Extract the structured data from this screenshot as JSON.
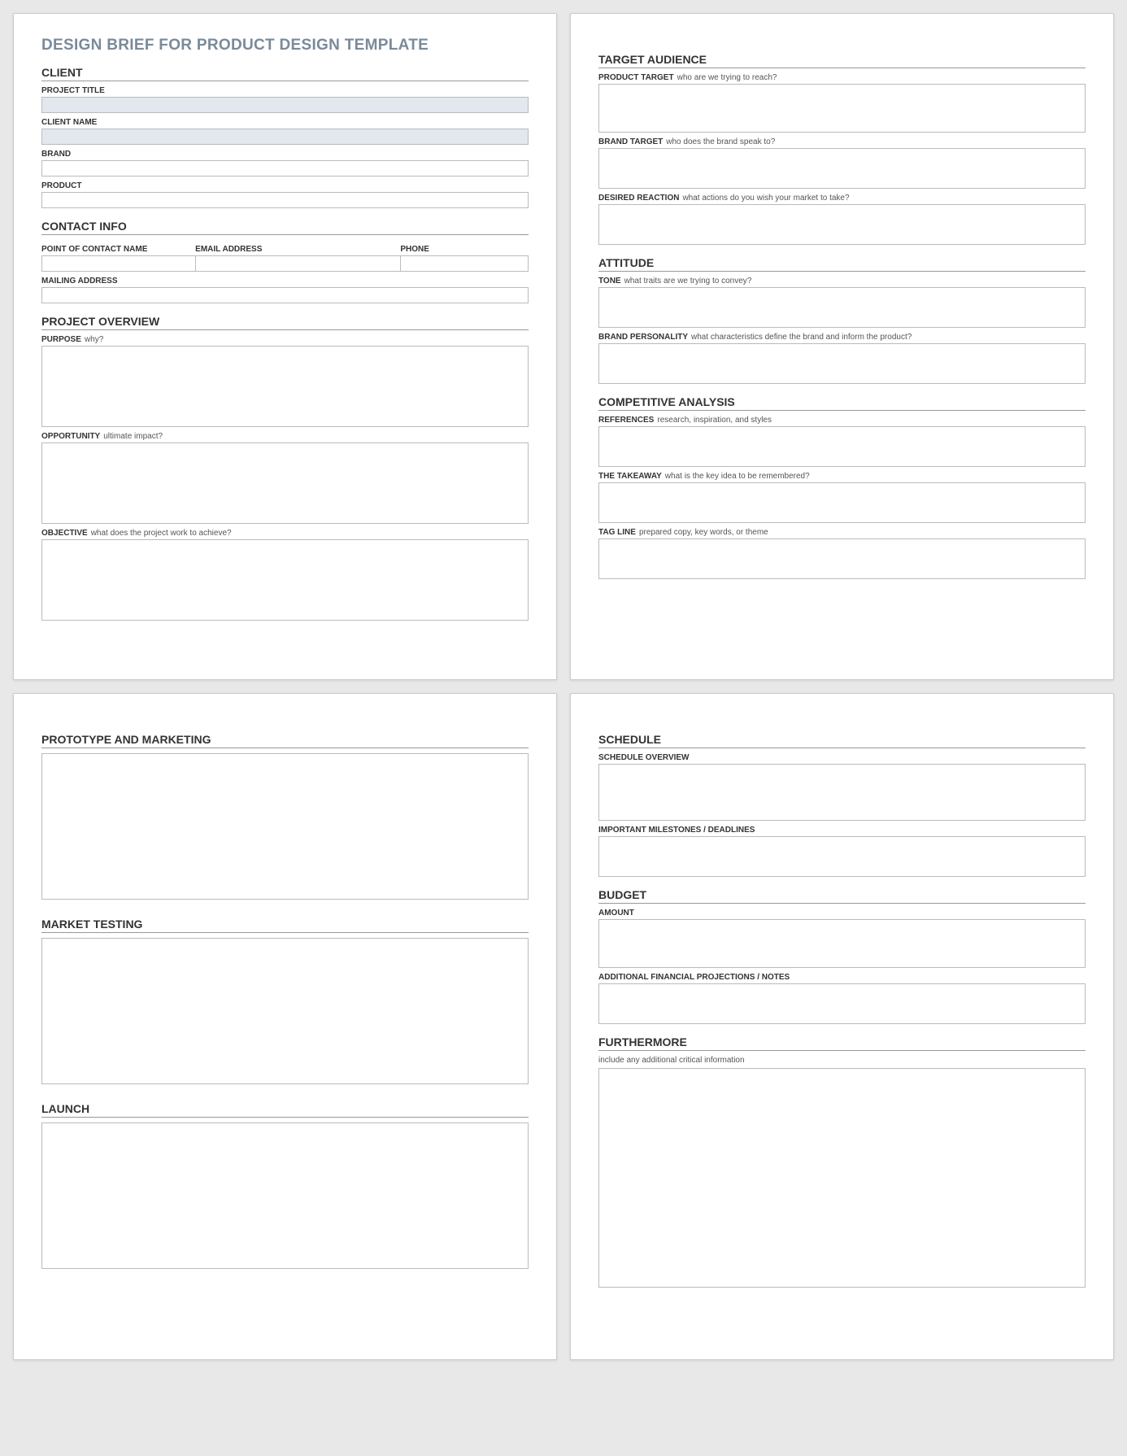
{
  "doc_title": "DESIGN BRIEF FOR PRODUCT DESIGN TEMPLATE",
  "p1l": {
    "client_head": "CLIENT",
    "project_title_label": "PROJECT TITLE",
    "client_name_label": "CLIENT NAME",
    "brand_label": "BRAND",
    "product_label": "PRODUCT",
    "contact_head": "CONTACT INFO",
    "poc_label": "POINT OF CONTACT NAME",
    "email_label": "EMAIL ADDRESS",
    "phone_label": "PHONE",
    "mailing_label": "MAILING ADDRESS",
    "overview_head": "PROJECT OVERVIEW",
    "purpose_label": "PURPOSE",
    "purpose_hint": "why?",
    "opportunity_label": "OPPORTUNITY",
    "opportunity_hint": "ultimate impact?",
    "objective_label": "OBJECTIVE",
    "objective_hint": "what does the project work to achieve?"
  },
  "p1r": {
    "audience_head": "TARGET AUDIENCE",
    "product_target_label": "PRODUCT TARGET",
    "product_target_hint": "who are we trying to reach?",
    "brand_target_label": "BRAND TARGET",
    "brand_target_hint": "who does the brand speak to?",
    "reaction_label": "DESIRED REACTION",
    "reaction_hint": "what actions do you wish your market to take?",
    "attitude_head": "ATTITUDE",
    "tone_label": "TONE",
    "tone_hint": "what traits are we trying to convey?",
    "personality_label": "BRAND PERSONALITY",
    "personality_hint": "what characteristics define the brand and inform the product?",
    "competitive_head": "COMPETITIVE ANALYSIS",
    "references_label": "REFERENCES",
    "references_hint": "research, inspiration, and styles",
    "takeaway_label": "THE TAKEAWAY",
    "takeaway_hint": "what is the key idea to be remembered?",
    "tagline_label": "TAG LINE",
    "tagline_hint": "prepared copy, key words, or theme"
  },
  "p2l": {
    "proto_head": "PROTOTYPE AND MARKETING",
    "market_head": "MARKET TESTING",
    "launch_head": "LAUNCH"
  },
  "p2r": {
    "schedule_head": "SCHEDULE",
    "schedule_overview_label": "SCHEDULE OVERVIEW",
    "milestones_label": "IMPORTANT MILESTONES / DEADLINES",
    "budget_head": "BUDGET",
    "amount_label": "AMOUNT",
    "finproj_label": "ADDITIONAL FINANCIAL PROJECTIONS / NOTES",
    "furthermore_head": "FURTHERMORE",
    "furthermore_hint": "include any additional critical information"
  }
}
